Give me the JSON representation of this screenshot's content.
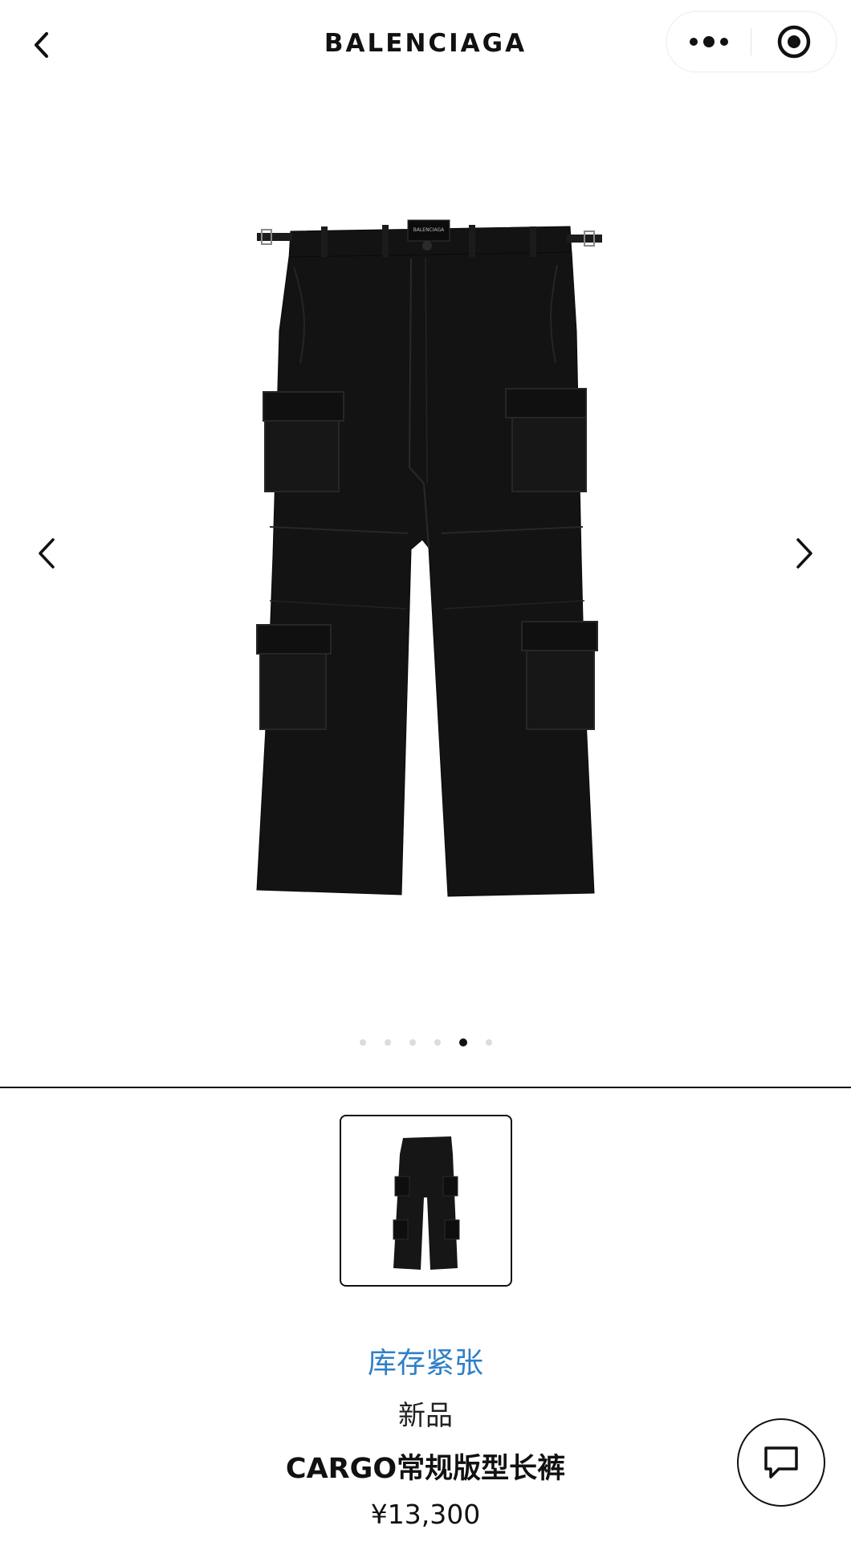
{
  "header": {
    "title": "BALENCIAGA",
    "back_icon": "chevron-left-icon",
    "more_icon": "more-dots-icon",
    "target_icon": "target-icon"
  },
  "gallery": {
    "image_label": "BALENCIAGA",
    "prev_icon": "chevron-left-icon",
    "next_icon": "chevron-right-icon",
    "dot_count": 6,
    "active_dot": 5
  },
  "product": {
    "stock_status": "库存紧张",
    "new_tag": "新品",
    "name": "CARGO常规版型长裤",
    "price": "¥13,300"
  },
  "chat": {
    "icon": "chat-icon"
  },
  "colors": {
    "stock": "#2f7fc7",
    "text": "#111111",
    "garment": "#131313"
  }
}
